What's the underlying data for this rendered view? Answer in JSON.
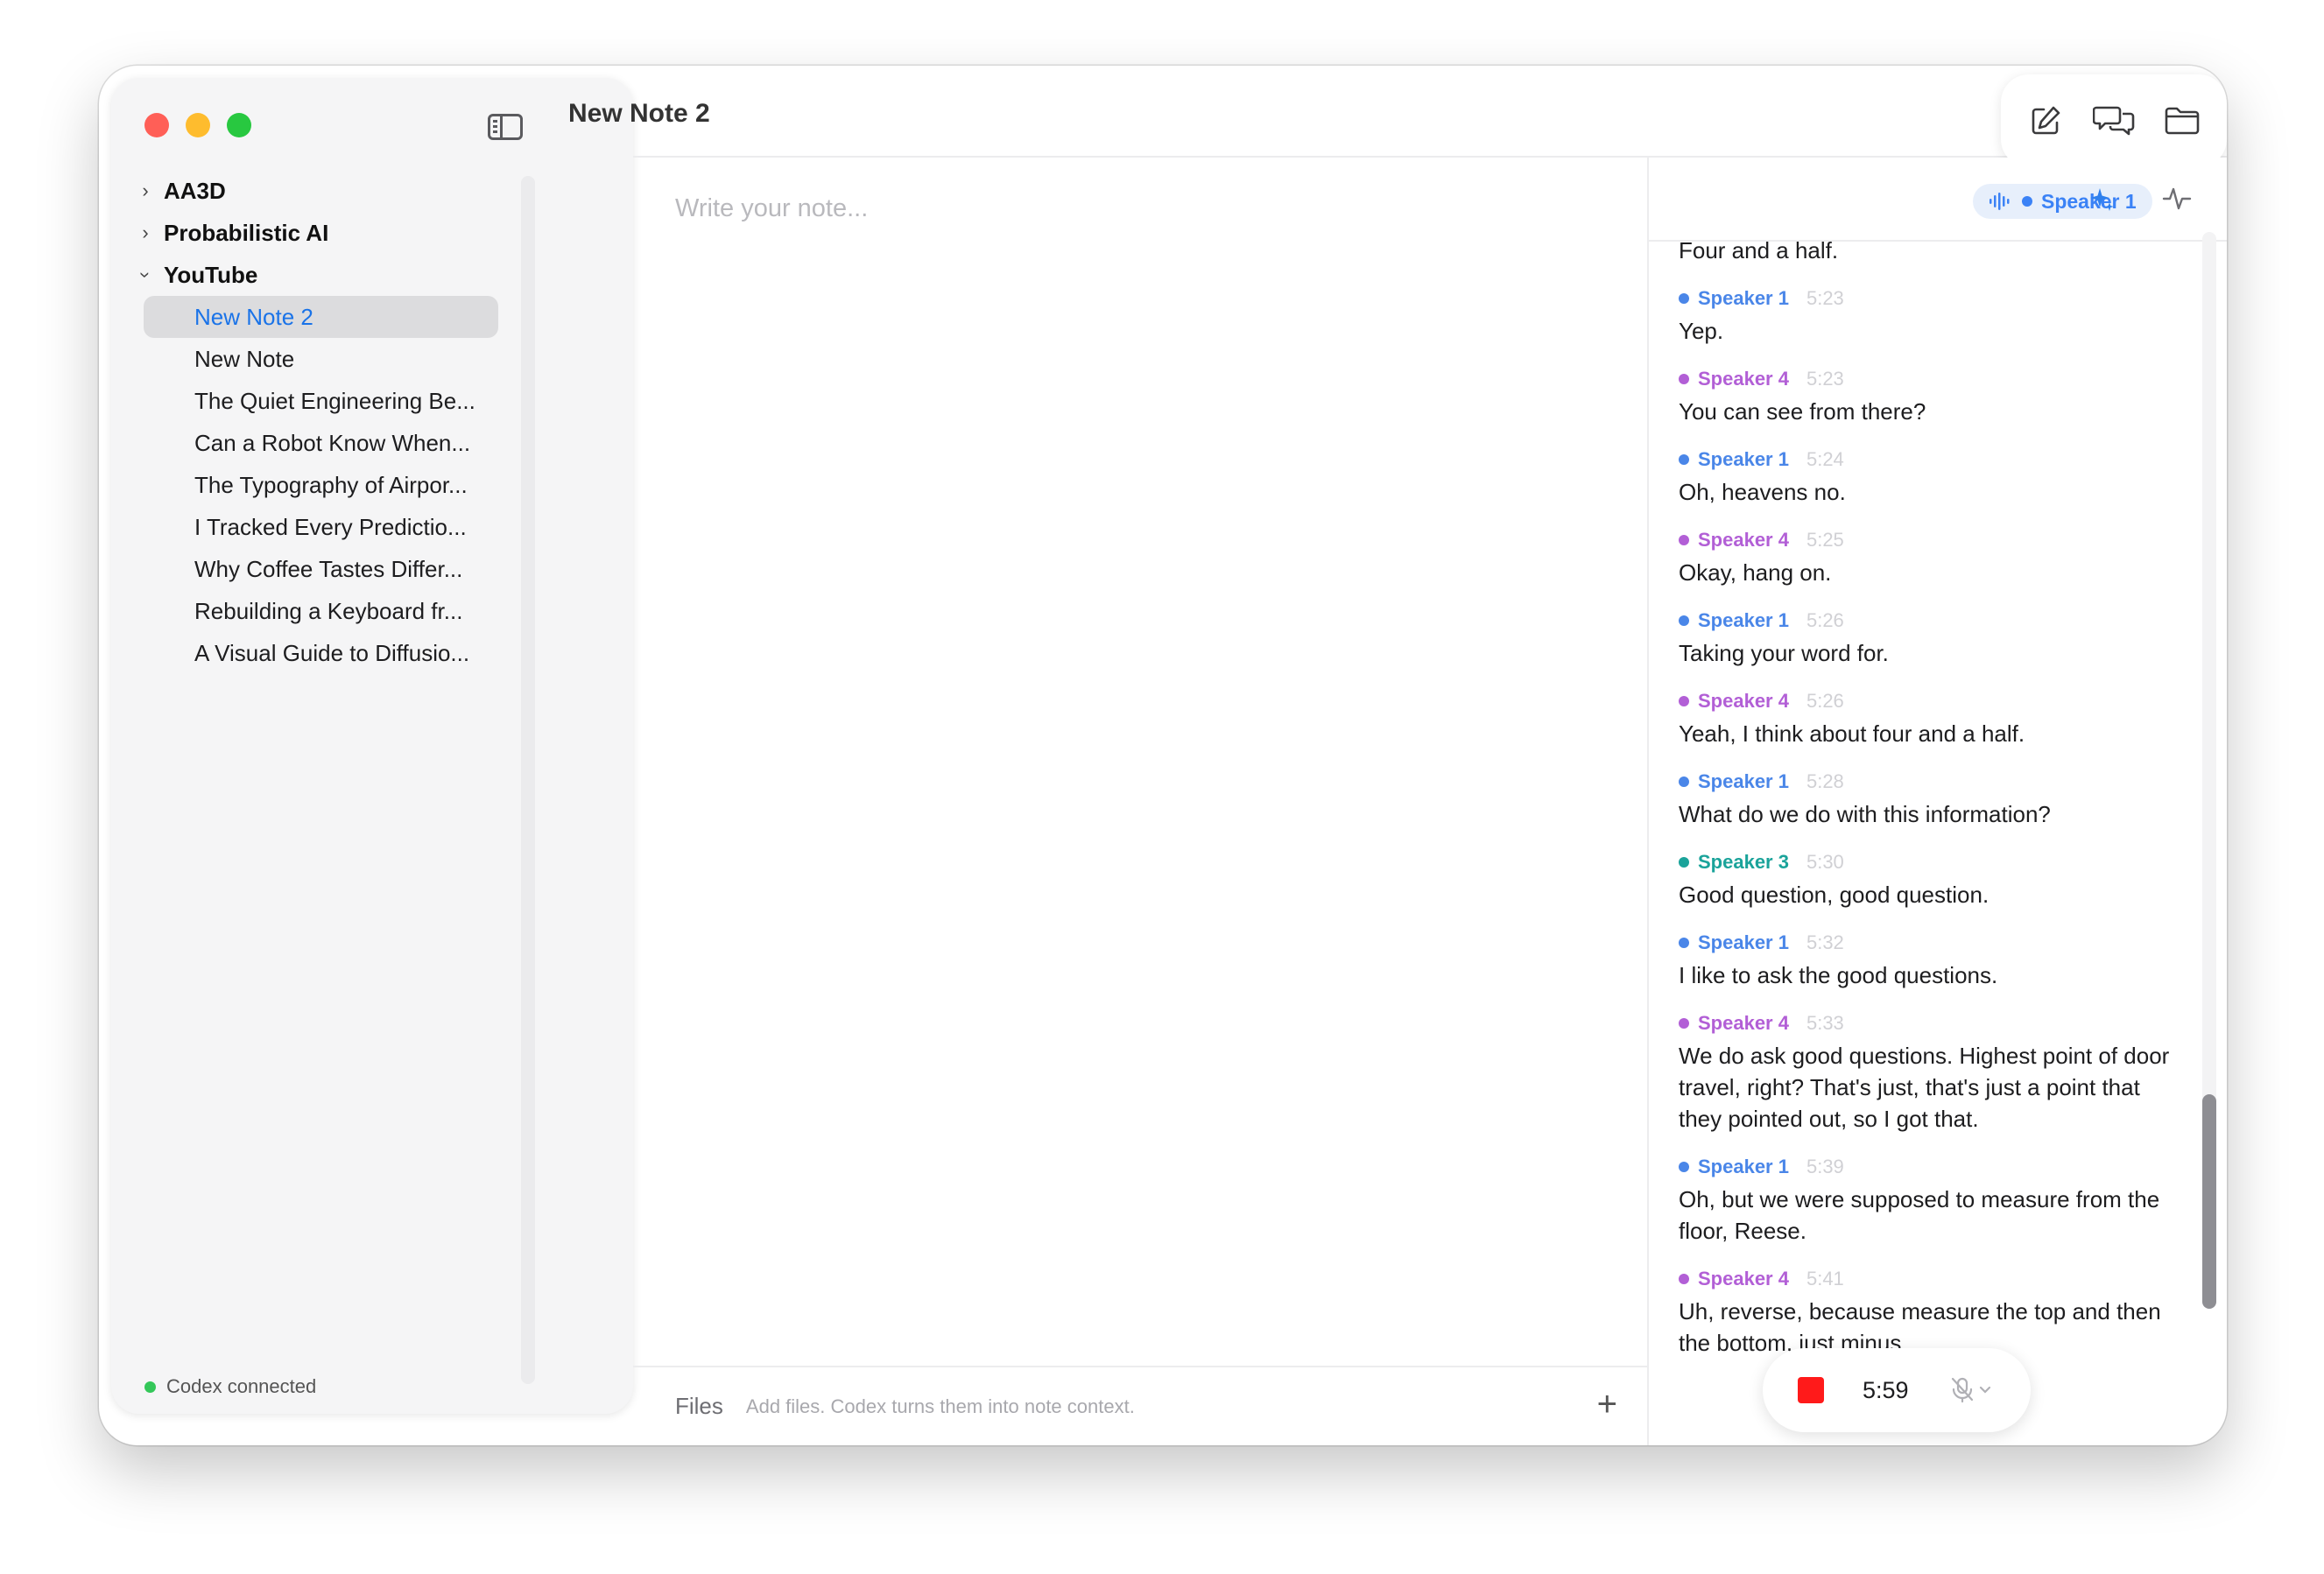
{
  "window": {
    "title": "New Note 2"
  },
  "sidebar": {
    "folders": [
      {
        "label": "AA3D",
        "expanded": false
      },
      {
        "label": "Probabilistic AI",
        "expanded": false
      },
      {
        "label": "YouTube",
        "expanded": true
      }
    ],
    "notes": [
      {
        "label": "New Note 2",
        "selected": true
      },
      {
        "label": "New Note",
        "selected": false
      },
      {
        "label": "The Quiet Engineering Be...",
        "selected": false
      },
      {
        "label": "Can a Robot Know When...",
        "selected": false
      },
      {
        "label": "The Typography of Airpor...",
        "selected": false
      },
      {
        "label": "I Tracked Every Predictio...",
        "selected": false
      },
      {
        "label": "Why Coffee Tastes Differ...",
        "selected": false
      },
      {
        "label": "Rebuilding a Keyboard fr...",
        "selected": false
      },
      {
        "label": "A Visual Guide to Diffusio...",
        "selected": false
      }
    ],
    "status": "Codex connected"
  },
  "editor": {
    "placeholder": "Write your note..."
  },
  "files": {
    "label": "Files",
    "hint": "Add files. Codex turns them into note context.",
    "add": "+"
  },
  "transcript_header": {
    "speaker_filter": "Speaker 1"
  },
  "speaker_colors": {
    "Speaker 1": "#4a86e8",
    "Speaker 3": "#1aa39a",
    "Speaker 4": "#b25fd6"
  },
  "transcript": {
    "leading_text": "Four and a half.",
    "entries": [
      {
        "speaker": "Speaker 1",
        "time": "5:23",
        "text": "Yep."
      },
      {
        "speaker": "Speaker 4",
        "time": "5:23",
        "text": "You can see from there?"
      },
      {
        "speaker": "Speaker 1",
        "time": "5:24",
        "text": "Oh, heavens no."
      },
      {
        "speaker": "Speaker 4",
        "time": "5:25",
        "text": "Okay, hang on."
      },
      {
        "speaker": "Speaker 1",
        "time": "5:26",
        "text": "Taking your word for."
      },
      {
        "speaker": "Speaker 4",
        "time": "5:26",
        "text": "Yeah, I think about four and a half."
      },
      {
        "speaker": "Speaker 1",
        "time": "5:28",
        "text": "What do we do with this information?"
      },
      {
        "speaker": "Speaker 3",
        "time": "5:30",
        "text": "Good question, good question."
      },
      {
        "speaker": "Speaker 1",
        "time": "5:32",
        "text": "I like to ask the good questions."
      },
      {
        "speaker": "Speaker 4",
        "time": "5:33",
        "text": "We do ask good questions. Highest point of door travel, right? That's just, that's just a point that they pointed out, so I got that."
      },
      {
        "speaker": "Speaker 1",
        "time": "5:39",
        "text": "Oh, but we were supposed to measure from the floor, Reese."
      },
      {
        "speaker": "Speaker 4",
        "time": "5:41",
        "text": "Uh, reverse, because measure the top and then the bottom, just minus."
      }
    ]
  },
  "recorder": {
    "elapsed": "5:59"
  }
}
